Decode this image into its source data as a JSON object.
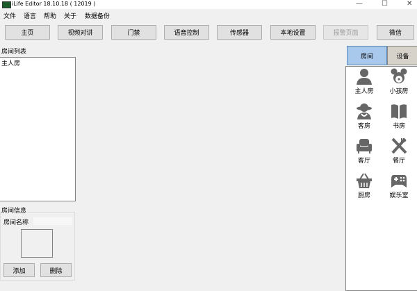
{
  "window": {
    "title": "iLife Editor 18.10.18 ( 12019 )",
    "minimize": "—",
    "maximize": "☐",
    "close": "✕"
  },
  "menu": [
    "文件",
    "语言",
    "帮助",
    "关于",
    "数据备份"
  ],
  "toolbar": [
    {
      "label": "主页",
      "enabled": true
    },
    {
      "label": "视频对讲",
      "enabled": true
    },
    {
      "label": "门禁",
      "enabled": true
    },
    {
      "label": "语音控制",
      "enabled": true
    },
    {
      "label": "传感器",
      "enabled": true
    },
    {
      "label": "本地设置",
      "enabled": true
    },
    {
      "label": "报警页面",
      "enabled": false
    },
    {
      "label": "微信",
      "enabled": true
    }
  ],
  "room_list": {
    "label": "房间列表",
    "items": [
      "主人房"
    ]
  },
  "room_info": {
    "label": "房间信息",
    "name_label": "房间名称",
    "name_value": "",
    "add": "添加",
    "delete": "删除"
  },
  "right_panel": {
    "tabs": [
      "房间",
      "设备"
    ],
    "active_tab": "房间",
    "active_color": "#a8c8ec",
    "rooms": [
      {
        "label": "主人房",
        "icon": "person-icon"
      },
      {
        "label": "小孩房",
        "icon": "mouse-face-icon"
      },
      {
        "label": "客房",
        "icon": "guest-icon"
      },
      {
        "label": "书房",
        "icon": "book-icon"
      },
      {
        "label": "客厅",
        "icon": "armchair-icon"
      },
      {
        "label": "餐厅",
        "icon": "fork-knife-icon"
      },
      {
        "label": "厨房",
        "icon": "basket-icon"
      },
      {
        "label": "娱乐室",
        "icon": "gamepad-icon"
      }
    ]
  }
}
